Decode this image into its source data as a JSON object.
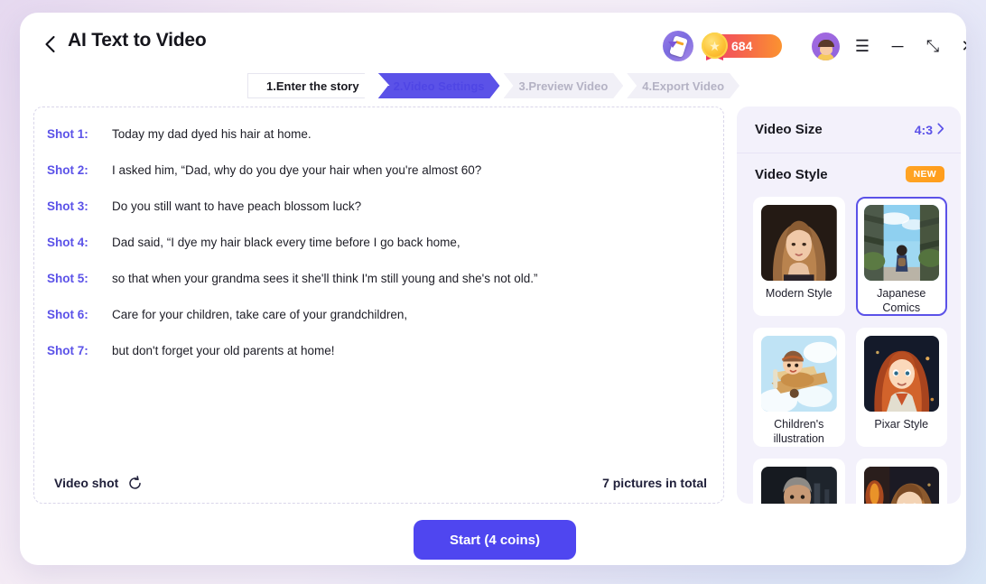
{
  "window": {
    "title": "AI Text to Video",
    "back_icon": "chevron-left-icon",
    "mobile_icon": "mobile-download-icon",
    "coins": "684",
    "coin_icon": "medal-star-icon",
    "avatar_icon": "user-avatar",
    "menu_icon": "hamburger-menu-icon",
    "minimize_icon": "minimize-icon",
    "expand_icon": "expand-icon",
    "close_icon": "close-icon",
    "minimize_glyph": "─",
    "expand_glyph": "⤡",
    "close_glyph": "✕",
    "menu_glyph": "☰"
  },
  "stepper": {
    "steps": [
      {
        "label": "1.Enter the story",
        "state": "done"
      },
      {
        "label": "2.Video Settings",
        "state": "current"
      },
      {
        "label": "3.Preview Video",
        "state": "todo"
      },
      {
        "label": "4.Export Video",
        "state": "todo"
      }
    ]
  },
  "story": {
    "shots": [
      {
        "label": "Shot 1:",
        "text": "Today my dad dyed his hair at home."
      },
      {
        "label": "Shot 2:",
        "text": "I asked him, “Dad, why do you dye your hair when you're almost 60?"
      },
      {
        "label": "Shot 3:",
        "text": "Do you still want to have peach blossom luck?"
      },
      {
        "label": "Shot 4:",
        "text": "Dad said, “I dye my hair black every time before I go back home,"
      },
      {
        "label": "Shot 5:",
        "text": "so that when your grandma sees it she'll think I'm still young and she's not old.”"
      },
      {
        "label": "Shot 6:",
        "text": "Care for your children, take care of your grandchildren,"
      },
      {
        "label": "Shot 7:",
        "text": "but don't forget your old parents at home!"
      }
    ],
    "footer": {
      "video_shot_label": "Video shot",
      "refresh_icon": "refresh-icon",
      "total": "7 pictures in total"
    }
  },
  "settings": {
    "video_size": {
      "label": "Video Size",
      "value": "4:3",
      "chevron_icon": "chevron-right-icon",
      "chevron_glyph": "›"
    },
    "video_style": {
      "label": "Video Style",
      "badge": "NEW",
      "styles": [
        {
          "name": "Modern Style",
          "selected": false,
          "thumb": "portrait-woman"
        },
        {
          "name": "Japanese Comics",
          "selected": true,
          "thumb": "anime-sky"
        },
        {
          "name": "Children's illustration",
          "selected": false,
          "thumb": "kid-plane"
        },
        {
          "name": "Pixar Style",
          "selected": false,
          "thumb": "pixar-girl"
        },
        {
          "name": "",
          "selected": false,
          "thumb": "man-dark"
        },
        {
          "name": "",
          "selected": false,
          "thumb": "woman-fire"
        }
      ]
    }
  },
  "actions": {
    "start_label": "Start (4 coins)"
  },
  "colors": {
    "accent": "#5b52e8",
    "start_button": "#4f46f0",
    "badge_orange": "#ff9d1c",
    "panel_bg": "#f3f1fb"
  }
}
